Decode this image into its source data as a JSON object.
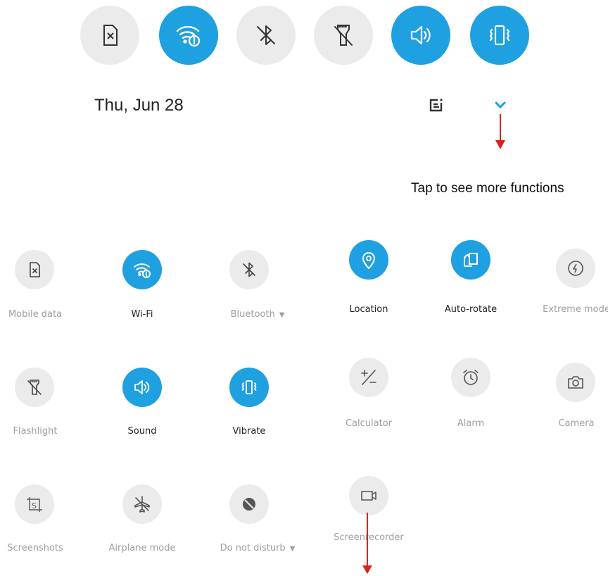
{
  "header": {
    "date": "Thu, Jun 28",
    "annotation": "Tap to see more functions"
  },
  "top_toggles": [
    {
      "name": "mobile-data",
      "on": false,
      "icon": "sim-off-icon"
    },
    {
      "name": "wifi",
      "on": true,
      "icon": "wifi-alert-icon"
    },
    {
      "name": "bluetooth",
      "on": false,
      "icon": "bluetooth-off-icon"
    },
    {
      "name": "flashlight",
      "on": false,
      "icon": "flashlight-off-icon"
    },
    {
      "name": "sound",
      "on": true,
      "icon": "volume-icon"
    },
    {
      "name": "vibrate",
      "on": true,
      "icon": "vibrate-icon"
    }
  ],
  "tiles": {
    "mobile_data": "Mobile data",
    "wifi": "Wi-Fi",
    "bluetooth": "Bluetooth",
    "location": "Location",
    "auto_rotate": "Auto-rotate",
    "extreme_mode": "Extreme mode",
    "flashlight": "Flashlight",
    "sound": "Sound",
    "vibrate": "Vibrate",
    "calculator": "Calculator",
    "alarm": "Alarm",
    "camera": "Camera",
    "screenshots": "Screenshots",
    "airplane_mode": "Airplane mode",
    "do_not_disturb": "Do not disturb",
    "screen_recorder": "Screenrecorder"
  },
  "colors": {
    "accent": "#1fa0e0",
    "tile_off": "#ebebeb",
    "annotation_arrow": "#e0201c"
  }
}
